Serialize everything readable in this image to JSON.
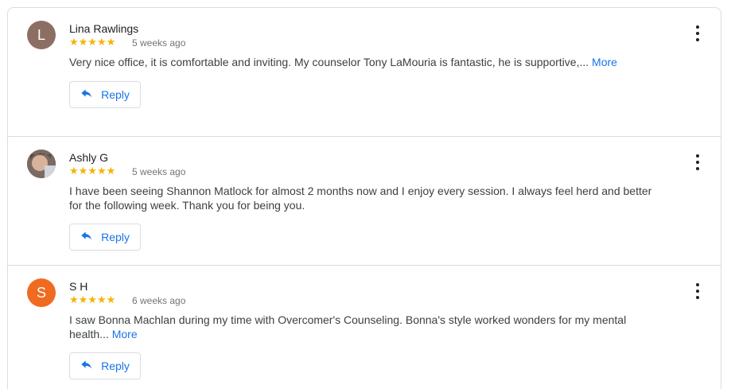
{
  "reviews": [
    {
      "name": "Lina Rawlings",
      "avatar_letter": "L",
      "avatar_color": "#8d6e63",
      "stars": "★★★★★",
      "rating": 5,
      "time": "5 weeks ago",
      "text": "Very nice office, it is comfortable and inviting. My counselor Tony LaMouria is fantastic, he is supportive,...",
      "more_label": "More",
      "reply_label": "Reply"
    },
    {
      "name": "Ashly G",
      "avatar_letter": "",
      "avatar_color": "#b98c74",
      "stars": "★★★★★",
      "rating": 5,
      "time": "5 weeks ago",
      "text": "I have been seeing Shannon Matlock for almost 2 months now and I enjoy every session. I always feel herd and better for the following week. Thank you for being you.",
      "more_label": "",
      "reply_label": "Reply"
    },
    {
      "name": "S H",
      "avatar_letter": "S",
      "avatar_color": "#f06b1f",
      "stars": "★★★★★",
      "rating": 5,
      "time": "6 weeks ago",
      "text": "I saw Bonna Machlan during my time with Overcomer's Counseling. Bonna's style worked wonders for my mental health...",
      "more_label": "More",
      "reply_label": "Reply"
    }
  ],
  "colors": {
    "star": "#f4b400",
    "link": "#1a73e8",
    "border": "#dadce0"
  },
  "icons": {
    "reply": "reply-arrow-icon",
    "menu": "more-vert-icon"
  }
}
